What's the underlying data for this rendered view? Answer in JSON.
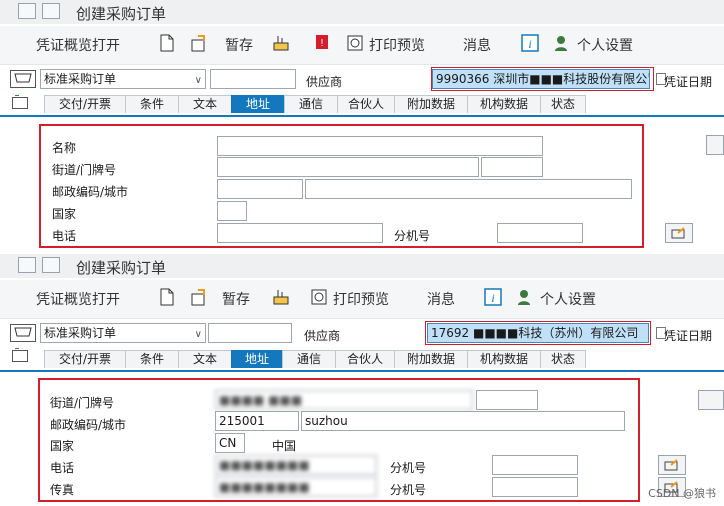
{
  "panel1": {
    "window_title": "创建采购订单",
    "toolbar": {
      "document_overview": "凭证概览打开",
      "hold": "暂存",
      "print_preview": "打印预览",
      "messages": "消息",
      "personal_settings": "个人设置"
    },
    "order_type": "标准采购订单",
    "supplier_label": "供应商",
    "supplier_value": "9990366 深圳市■■■科技股份有限公司",
    "doc_date_label": "凭证日期",
    "tabs": [
      "交付/开票",
      "条件",
      "文本",
      "地址",
      "通信",
      "合伙人",
      "附加数据",
      "机构数据",
      "状态"
    ],
    "active_tab": "地址",
    "fields": {
      "name_label": "名称",
      "street_label": "街道/门牌号",
      "postal_city_label": "邮政编码/城市",
      "country_label": "国家",
      "phone_label": "电话",
      "extension_label": "分机号"
    }
  },
  "panel2": {
    "window_title": "创建采购订单",
    "toolbar": {
      "document_overview": "凭证概览打开",
      "hold": "暂存",
      "print_preview": "打印预览",
      "messages": "消息",
      "personal_settings": "个人设置"
    },
    "order_type": "标准采购订单",
    "supplier_label": "供应商",
    "supplier_value": "17692 ■■■■科技（苏州）有限公司",
    "doc_date_label": "凭证日期",
    "tabs": [
      "交付/开票",
      "条件",
      "文本",
      "地址",
      "通信",
      "合伙人",
      "附加数据",
      "机构数据",
      "状态"
    ],
    "active_tab": "地址",
    "fields": {
      "street_label": "街道/门牌号",
      "street_value": "■■■■ ■■■",
      "postal_city_label": "邮政编码/城市",
      "postal_value": "215001",
      "city_value": "suzhou",
      "country_label": "国家",
      "country_code": "CN",
      "country_name": "中国",
      "phone_label": "电话",
      "phone_value": "■■■■■■■■",
      "fax_label": "传真",
      "fax_value": "■■■■■■■■",
      "extension_label": "分机号"
    }
  },
  "watermark": "CSDN @狼书",
  "colors": {
    "accent": "#1478bf",
    "highlight_box": "#d51e2b",
    "selected_field": "#bfe0f7"
  }
}
